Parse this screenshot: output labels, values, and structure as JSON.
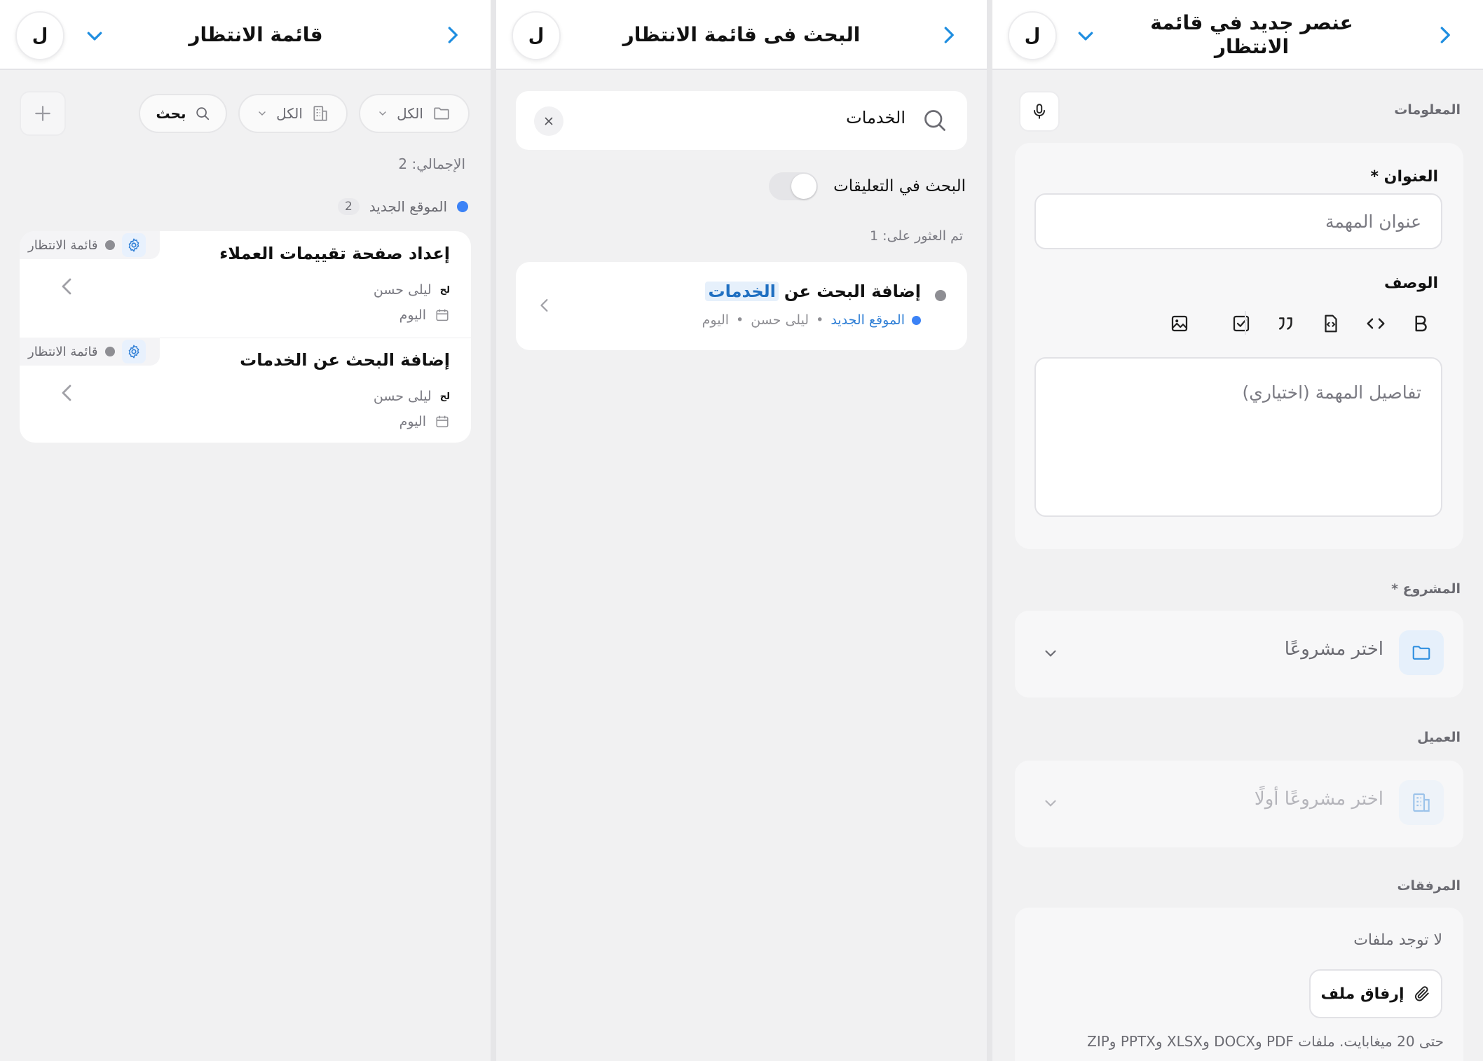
{
  "accent": "#1f8ee0",
  "panel1": {
    "avatar": "ل",
    "title": "قائمة الانتظار",
    "filters": {
      "folder_label": "الكل",
      "building_label": "الكل",
      "search_label": "بحث"
    },
    "total": "الإجمالي: 2",
    "group": {
      "name": "الموقع الجديد",
      "count": "2"
    },
    "items": [
      {
        "title": "إعداد صفحة تقييمات العملاء",
        "status": "قائمة الانتظار",
        "assignee": "ليلى حسن",
        "assignee_initials": "لح",
        "date": "اليوم"
      },
      {
        "title": "إضافة البحث عن الخدمات",
        "status": "قائمة الانتظار",
        "assignee": "ليلى حسن",
        "assignee_initials": "لح",
        "date": "اليوم"
      }
    ]
  },
  "panel2": {
    "avatar": "ل",
    "title": "البحث فى قائمة الانتظار",
    "search_query": "الخدمات",
    "toggle_label": "البحث في التعليقات",
    "found": "تم العثور على: 1",
    "result": {
      "title_prefix": "إضافة البحث عن",
      "title_highlight": "الخدمات",
      "project": "الموقع الجديد",
      "assignee": "ليلى حسن",
      "date": "اليوم"
    }
  },
  "panel3": {
    "avatar": "ل",
    "title_line1": "عنصر جديد في قائمة",
    "title_line2": "الانتظار",
    "info_label": "المعلومات",
    "title_field_label": "العنوان *",
    "title_placeholder": "عنوان المهمة",
    "desc_label": "الوصف",
    "desc_placeholder": "تفاصيل المهمة (اختياري)",
    "project_label": "المشروع *",
    "project_placeholder": "اختر مشروعًا",
    "client_label": "العميل",
    "client_placeholder": "اختر مشروعًا أولًا",
    "attachments_label": "المرفقات",
    "no_files": "لا توجد ملفات",
    "attach_button": "إرفاق ملف",
    "hint": "حتى 20 ميغابايت. ملفات PDF وDOCX وXLSX وPPTX وZIP"
  }
}
